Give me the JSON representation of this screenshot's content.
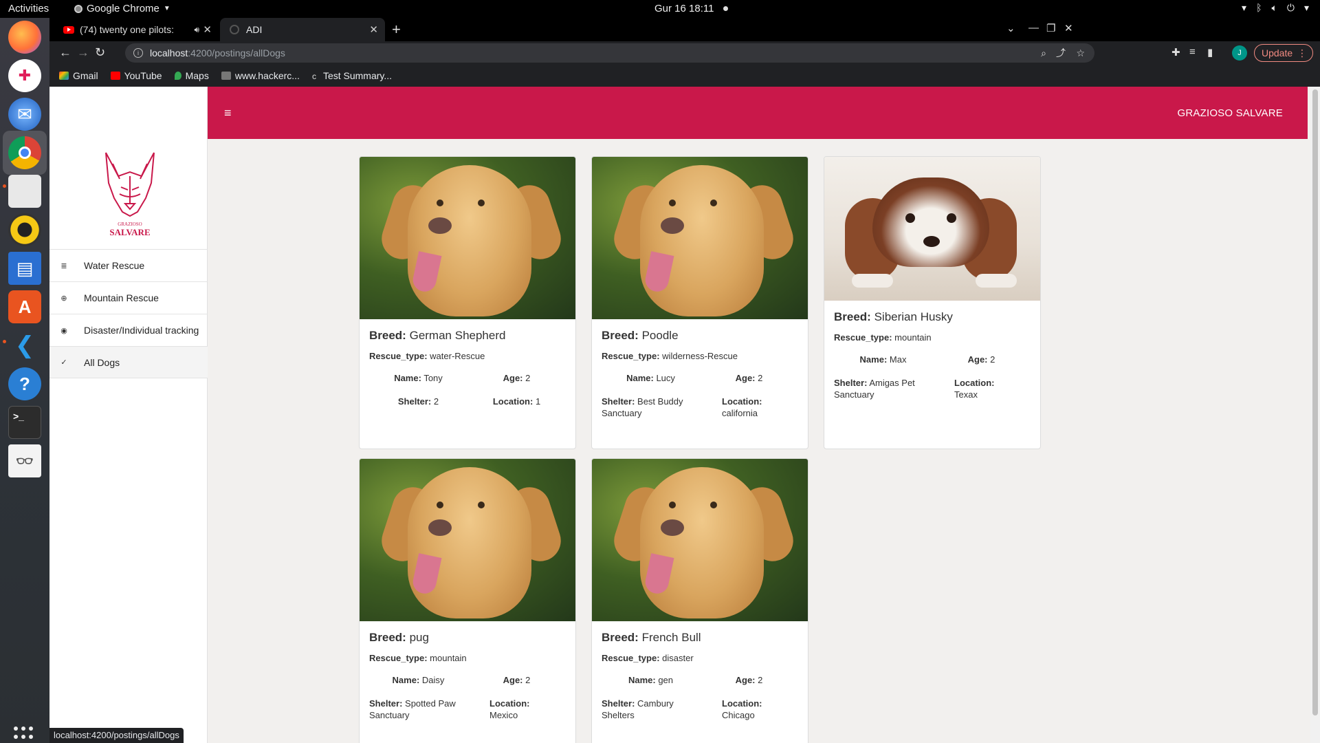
{
  "os": {
    "activities": "Activities",
    "app_menu": "Google Chrome",
    "clock": "Gur 16  18:11"
  },
  "browser": {
    "tabs": [
      {
        "title": "(74) twenty one pilots:"
      },
      {
        "title": "ADI"
      }
    ],
    "url_host": "localhost",
    "url_path": ":4200/postings/allDogs",
    "update_label": "Update",
    "profile_initial": "J",
    "bookmarks": [
      {
        "label": "Gmail"
      },
      {
        "label": "YouTube"
      },
      {
        "label": "Maps"
      },
      {
        "label": "www.hackerc..."
      },
      {
        "label": "Test Summary..."
      }
    ],
    "status_url": "localhost:4200/postings/allDogs"
  },
  "app": {
    "logo_line1": "GRAZIOSO",
    "logo_line2": "SALVARE",
    "brand": "GRAZIOSO SALVARE",
    "menu_icon": "hamburger-icon",
    "sidebar": [
      {
        "label": "Water Rescue",
        "icon": "water-icon"
      },
      {
        "label": "Mountain Rescue",
        "icon": "globe-icon"
      },
      {
        "label": "Disaster/Individual tracking",
        "icon": "person-icon"
      },
      {
        "label": "All Dogs",
        "icon": "check-icon"
      }
    ],
    "labels": {
      "breed": "Breed:",
      "rescue": "Rescue_type:",
      "name": "Name:",
      "age": "Age:",
      "shelter": "Shelter:",
      "location": "Location:"
    },
    "dogs": [
      {
        "breed": "German Shepherd",
        "rescue": "water-Rescue",
        "name": "Tony",
        "age": "2",
        "shelter": "2",
        "location": "1"
      },
      {
        "breed": "Poodle",
        "rescue": "wilderness-Rescue",
        "name": "Lucy",
        "age": "2",
        "shelter": "Best Buddy Sanctuary",
        "location": "california"
      },
      {
        "breed": "Siberian Husky",
        "rescue": "mountain",
        "name": "Max",
        "age": "2",
        "shelter": "Amigas Pet Sanctuary",
        "location": "Texax"
      },
      {
        "breed": "pug",
        "rescue": "mountain",
        "name": "Daisy",
        "age": "2",
        "shelter": "Spotted Paw Sanctuary",
        "location": "Mexico"
      },
      {
        "breed": "French Bull",
        "rescue": "disaster",
        "name": "gen",
        "age": "2",
        "shelter": "Cambury Shelters",
        "location": "Chicago"
      }
    ]
  },
  "colors": {
    "header": "#c9184a",
    "page_bg": "#f2f0ee"
  }
}
